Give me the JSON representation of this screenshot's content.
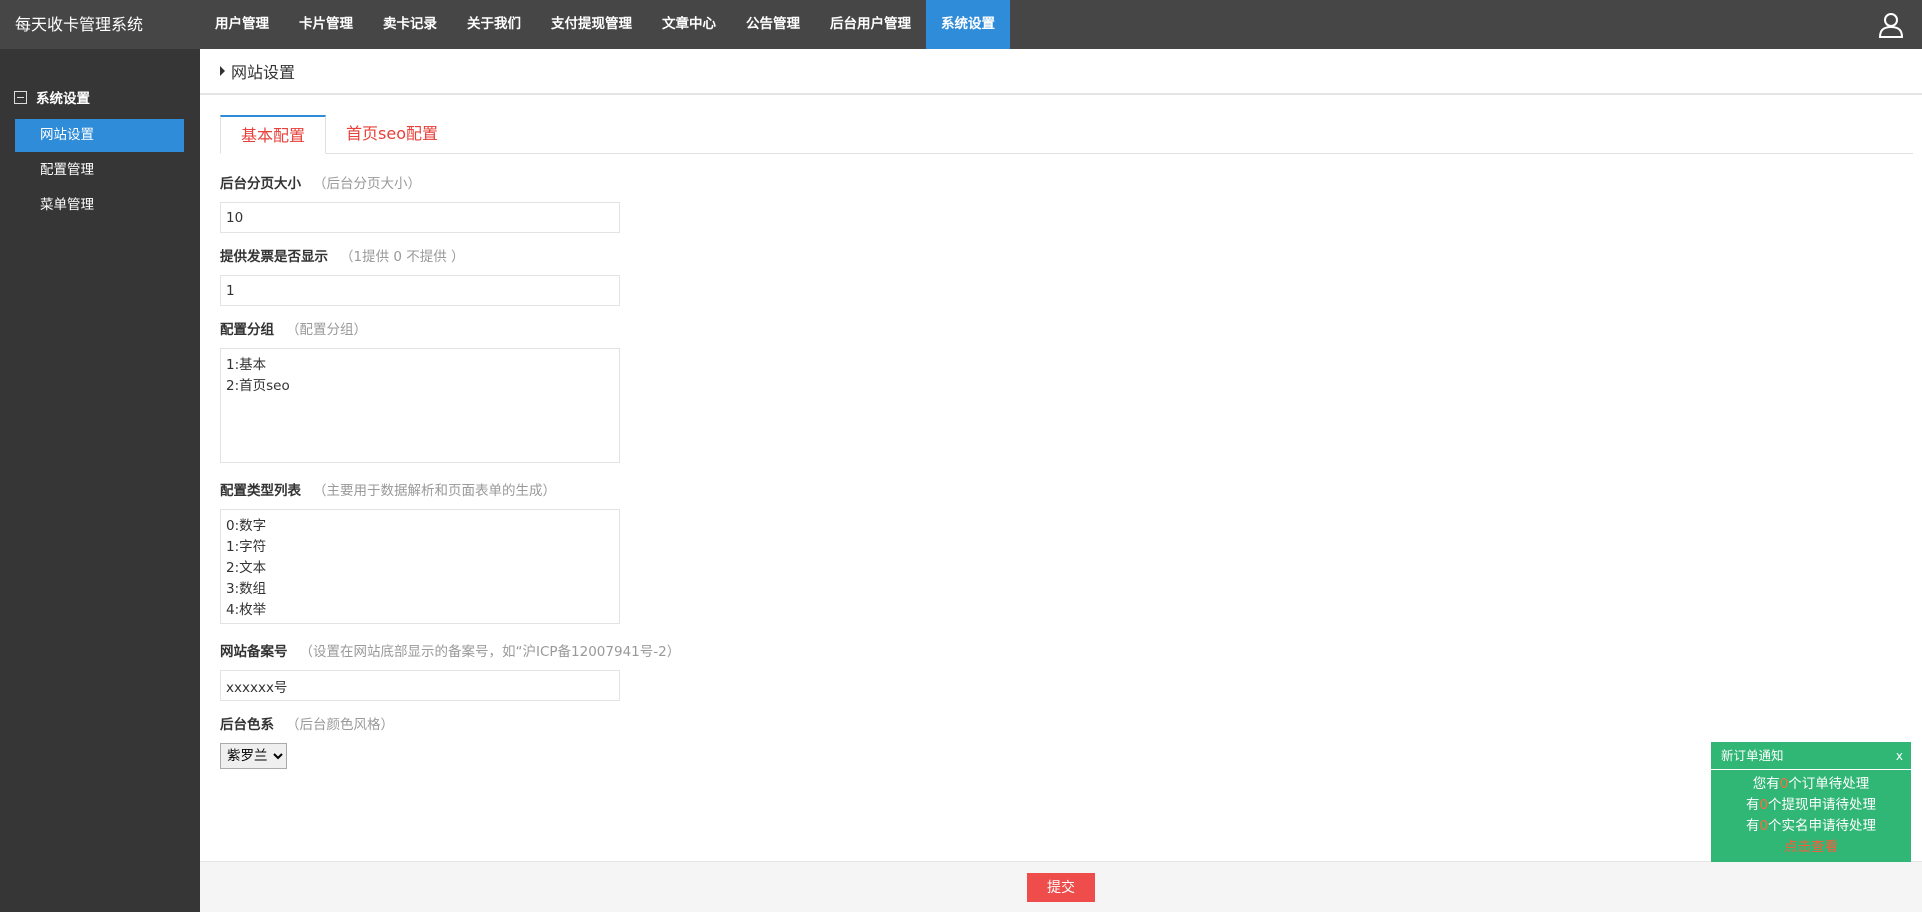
{
  "app": {
    "brand": "每天收卡管理系统"
  },
  "topnav": [
    {
      "label": "用户管理",
      "active": false
    },
    {
      "label": "卡片管理",
      "active": false
    },
    {
      "label": "卖卡记录",
      "active": false
    },
    {
      "label": "关于我们",
      "active": false
    },
    {
      "label": "支付提现管理",
      "active": false
    },
    {
      "label": "文章中心",
      "active": false
    },
    {
      "label": "公告管理",
      "active": false
    },
    {
      "label": "后台用户管理",
      "active": false
    },
    {
      "label": "系统设置",
      "active": true
    }
  ],
  "sidebar": {
    "group_title": "系统设置",
    "items": [
      {
        "label": "网站设置",
        "active": true
      },
      {
        "label": "配置管理",
        "active": false
      },
      {
        "label": "菜单管理",
        "active": false
      }
    ]
  },
  "page": {
    "title": "网站设置"
  },
  "tabs": [
    {
      "label": "基本配置",
      "active": true
    },
    {
      "label": "首页seo配置",
      "active": false
    }
  ],
  "fields": {
    "page_size": {
      "label": "后台分页大小",
      "hint": "（后台分页大小）",
      "value": "10"
    },
    "invoice": {
      "label": "提供发票是否显示",
      "hint": "（1提供 0 不提供 ）",
      "value": "1"
    },
    "config_group": {
      "label": "配置分组",
      "hint": "（配置分组）",
      "value": "1:基本\n2:首页seo"
    },
    "config_types": {
      "label": "配置类型列表",
      "hint": "（主要用于数据解析和页面表单的生成）",
      "value": "0:数字\n1:字符\n2:文本\n3:数组\n4:枚举"
    },
    "icp": {
      "label": "网站备案号",
      "hint": "（设置在网站底部显示的备案号，如“沪ICP备12007941号-2）",
      "value": "xxxxxx号"
    },
    "theme": {
      "label": "后台色系",
      "hint": "（后台颜色风格）",
      "selected": "紫罗兰"
    }
  },
  "footer": {
    "submit_label": "提交"
  },
  "notify": {
    "title": "新订单通知",
    "close": "x",
    "line1_pre": "您有",
    "line1_num": "0",
    "line1_post": "个订单待处理",
    "line2_pre": "有",
    "line2_num": "0",
    "line2_post": "个提现申请待处理",
    "line3_pre": "有",
    "line3_num": "0",
    "line3_post": "个实名申请待处理",
    "link": "点击查看"
  },
  "colors": {
    "topbar": "#464646",
    "sidebar": "#363636",
    "accent": "#2f8cd9",
    "tab_text": "#e8403a",
    "submit": "#ef4c4c",
    "notify": "#30b675"
  },
  "icons": {
    "user": "user-icon",
    "group": "minus-square-icon"
  }
}
